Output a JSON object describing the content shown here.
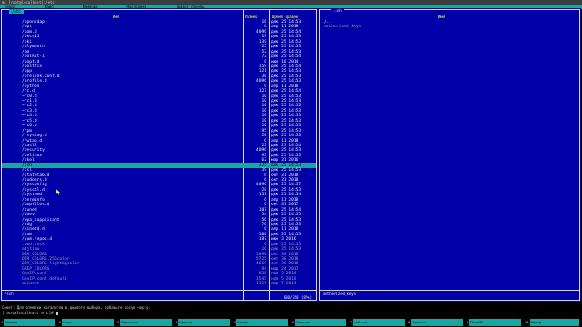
{
  "window": {
    "title": "mc [root@localhost]:/etc"
  },
  "menu": [
    "Левая",
    "Файл",
    "Команда",
    "Настройки",
    "Правая панель"
  ],
  "left_panel": {
    "tab": "/etc",
    "columns": {
      "name": "Имя",
      "size": "Размер",
      "time": "Время правки"
    },
    "rows": [
      {
        "name": "/openldap",
        "size": "16",
        "time": "дек 25 14:53",
        "state": "normal"
      },
      {
        "name": "/opt",
        "size": "6",
        "time": "апр 11 2018",
        "state": "normal"
      },
      {
        "name": "/pam.d",
        "size": "4096",
        "time": "дек 25 14:54",
        "state": "normal"
      },
      {
        "name": "/pkcs11",
        "size": "19",
        "time": "дек 25 14:53",
        "state": "normal"
      },
      {
        "name": "/pki",
        "size": "139",
        "time": "дек 25 14:53",
        "state": "normal"
      },
      {
        "name": "/plymouth",
        "size": "25",
        "time": "дек 25 14:53",
        "state": "normal"
      },
      {
        "name": "/pm",
        "size": "52",
        "time": "дек 25 14:53",
        "state": "normal"
      },
      {
        "name": "/polkit-1",
        "size": "72",
        "time": "дек 25 14:54",
        "state": "normal"
      },
      {
        "name": "/popt.d",
        "size": "6",
        "time": "июн 10 2014",
        "state": "normal"
      },
      {
        "name": "/postfix",
        "size": "159",
        "time": "дек 25 14:54",
        "state": "normal"
      },
      {
        "name": "/ppp",
        "size": "121",
        "time": "дек 25 14:53",
        "state": "normal"
      },
      {
        "name": "/prelink.conf.d",
        "size": "30",
        "time": "дек 25 14:53",
        "state": "normal"
      },
      {
        "name": "/profile.d",
        "size": "4096",
        "time": "дек 25 14:53",
        "state": "normal"
      },
      {
        "name": "/python",
        "size": "6",
        "time": "апр 11 2018",
        "state": "normal"
      },
      {
        "name": "/rc.d",
        "size": "127",
        "time": "дек 25 14:54",
        "state": "normal"
      },
      {
        "name": "~rc0.d",
        "size": "10",
        "time": "дек 25 14:53",
        "state": "normal"
      },
      {
        "name": "~rc1.d",
        "size": "10",
        "time": "дек 25 14:53",
        "state": "normal"
      },
      {
        "name": "~rc2.d",
        "size": "10",
        "time": "дек 25 14:53",
        "state": "normal"
      },
      {
        "name": "~rc3.d",
        "size": "10",
        "time": "дек 25 14:53",
        "state": "normal"
      },
      {
        "name": "~rc4.d",
        "size": "10",
        "time": "дек 25 14:53",
        "state": "normal"
      },
      {
        "name": "~rc5.d",
        "size": "10",
        "time": "дек 25 14:53",
        "state": "normal"
      },
      {
        "name": "~rc6.d",
        "size": "10",
        "time": "дек 25 14:53",
        "state": "normal"
      },
      {
        "name": "/rpm",
        "size": "95",
        "time": "дек 25 14:53",
        "state": "normal"
      },
      {
        "name": "/rsyslog.d",
        "size": "20",
        "time": "дек 25 14:53",
        "state": "normal"
      },
      {
        "name": "/rwtab.d",
        "size": "6",
        "time": "апр 11 2018",
        "state": "normal"
      },
      {
        "name": "/sasl2",
        "size": "23",
        "time": "дек 25 14:54",
        "state": "normal"
      },
      {
        "name": "/security",
        "size": "4096",
        "time": "дек 25 14:53",
        "state": "normal"
      },
      {
        "name": "/selinux",
        "size": "93",
        "time": "дек 25 14:53",
        "state": "normal"
      },
      {
        "name": "/skel",
        "size": "62",
        "time": "мар 31 2016",
        "state": "normal"
      },
      {
        "name": "/ssh",
        "size": "225",
        "time": "дек 25 14:53",
        "state": "selected"
      },
      {
        "name": "/ssl",
        "size": "39",
        "time": "дек 25 14:53",
        "state": "normal"
      },
      {
        "name": "/statetab.d",
        "size": "6",
        "time": "окт 31 2018",
        "state": "normal"
      },
      {
        "name": "/sudoers.d",
        "size": "6",
        "time": "окт 31 2018",
        "state": "normal"
      },
      {
        "name": "/sysconfig",
        "size": "4096",
        "time": "дек 25 14:57",
        "state": "normal"
      },
      {
        "name": "/sysctl.d",
        "size": "28",
        "time": "дек 25 14:53",
        "state": "normal"
      },
      {
        "name": "/systemd",
        "size": "131",
        "time": "дек 25 14:54",
        "state": "normal"
      },
      {
        "name": "/terminfo",
        "size": "6",
        "time": "апр 11 2018",
        "state": "normal"
      },
      {
        "name": "/tmpfiles.d",
        "size": "6",
        "time": "окт 31 2017",
        "state": "normal"
      },
      {
        "name": "/tuned",
        "size": "107",
        "time": "дек 25 14:54",
        "state": "normal"
      },
      {
        "name": "/udev",
        "size": "54",
        "time": "дек 25 14:55",
        "state": "normal"
      },
      {
        "name": "/wpa_supplicant",
        "size": "56",
        "time": "дек 25 14:53",
        "state": "normal"
      },
      {
        "name": "/xdg",
        "size": "70",
        "time": "дек 25 14:53",
        "state": "normal"
      },
      {
        "name": "/xinetd.d",
        "size": "6",
        "time": "апр 11 2018",
        "state": "normal"
      },
      {
        "name": "/yum",
        "size": "100",
        "time": "дек 25 14:53",
        "state": "normal"
      },
      {
        "name": "/yum.repos.d",
        "size": "187",
        "time": "июн 3 2016",
        "state": "normal"
      },
      {
        "name": ".pwd.lock",
        "size": "0",
        "time": "дек 25 14:53",
        "state": "dim"
      },
      {
        "name": "adjtime",
        "size": "16",
        "time": "дек 25 14:53",
        "state": "dim"
      },
      {
        "name": "DIR_COLORS",
        "size": "5090",
        "time": "окт 30 2018",
        "state": "dim"
      },
      {
        "name": "DIR_COLORS.256color",
        "size": "5725",
        "time": "окт 30 2018",
        "state": "dim"
      },
      {
        "name": "DIR_COLORS.lightbgcolor",
        "size": "4669",
        "time": "окт 30 2018",
        "state": "dim"
      },
      {
        "name": "GREP_COLORS",
        "size": "94",
        "time": "мар 24 2017",
        "state": "dim"
      },
      {
        "name": "GeoIP.conf",
        "size": "858",
        "time": "ноя 5 2018",
        "state": "dim"
      },
      {
        "name": "GeoIP.conf.default",
        "size": "1545",
        "time": "ноя 5 2018",
        "state": "dim"
      },
      {
        "name": "aliases",
        "size": "1529",
        "time": "апр 7 2013",
        "state": "dim"
      }
    ],
    "footer_name": "/ssh",
    "count": "680/350 (87%)"
  },
  "right_panel": {
    "title": ".ssh",
    "columns": {
      "name": "Имя"
    },
    "rows": [
      {
        "name": "/..",
        "state": "normal"
      },
      {
        "name": "authorized_keys",
        "state": "dim"
      }
    ],
    "footer_name": "authorized_keys"
  },
  "hint": "Совет: Для отметки каталогов в диалоге выбора, добавьте косую черту.",
  "prompt": "[root@localhost etc]#",
  "fkeys": [
    {
      "num": "1",
      "label": "Помощь"
    },
    {
      "num": "2",
      "label": "Меню"
    },
    {
      "num": "3",
      "label": "Просмотр"
    },
    {
      "num": "4",
      "label": "Правка"
    },
    {
      "num": "5",
      "label": "Копия"
    },
    {
      "num": "6",
      "label": "Перенос"
    },
    {
      "num": "7",
      "label": "НвКтлог"
    },
    {
      "num": "8",
      "label": "Удалить"
    },
    {
      "num": "9",
      "label": "МенюMC"
    },
    {
      "num": "10",
      "label": "Выход"
    }
  ],
  "colors": {
    "panel": "#0000a8",
    "highlight": "#1aa5a5",
    "header": "#ffff55"
  }
}
